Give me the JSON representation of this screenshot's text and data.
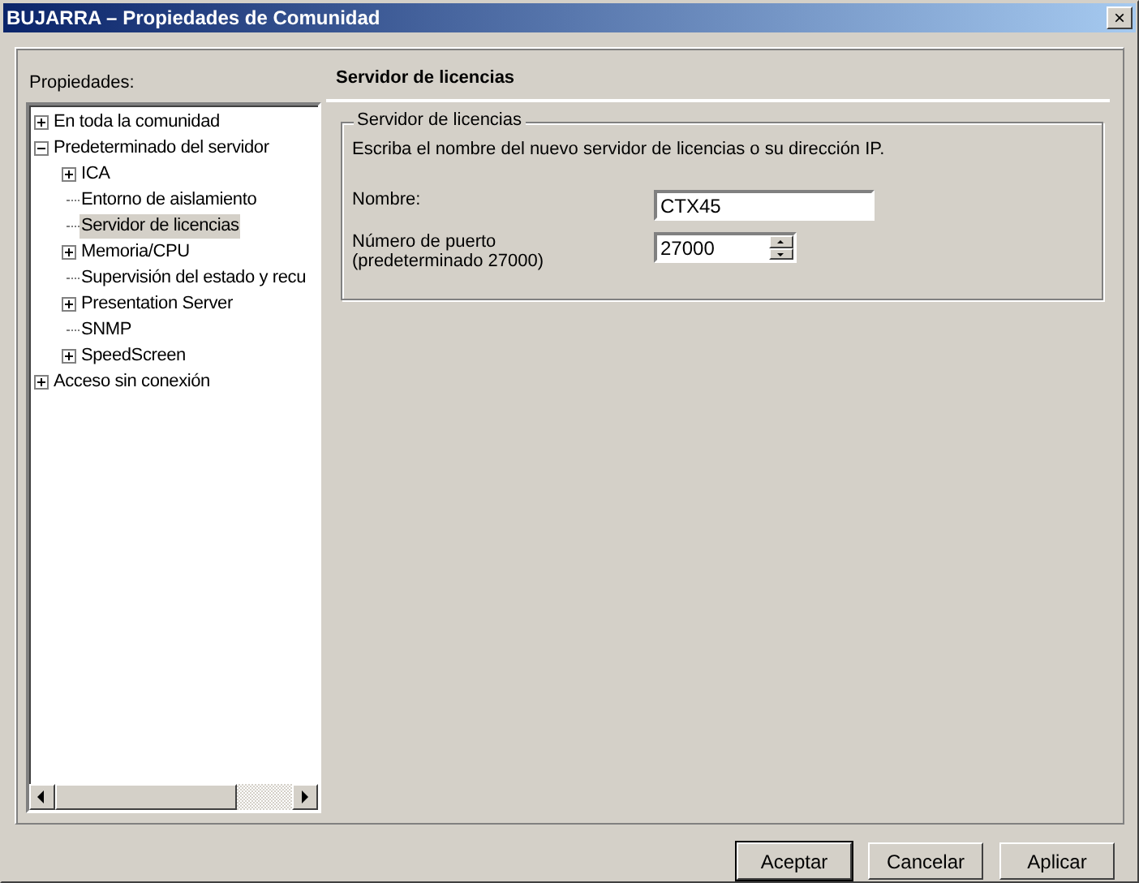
{
  "window": {
    "title": "BUJARRA – Propiedades de Comunidad",
    "close": "×"
  },
  "properties_label": "Propiedades:",
  "tree": [
    {
      "label": "En toda la comunidad",
      "kind": "folder",
      "expanded": false,
      "selected": false
    },
    {
      "label": "Predeterminado del servidor",
      "kind": "folder",
      "expanded": true,
      "selected": false,
      "children": [
        {
          "label": "ICA",
          "kind": "folder",
          "expanded": false,
          "selected": false
        },
        {
          "label": "Entorno de aislamiento",
          "kind": "leaf",
          "selected": false
        },
        {
          "label": "Servidor de licencias",
          "kind": "leaf",
          "selected": true
        },
        {
          "label": "Memoria/CPU",
          "kind": "folder",
          "expanded": false,
          "selected": false
        },
        {
          "label": "Supervisión del estado y recu",
          "kind": "leaf",
          "selected": false
        },
        {
          "label": "Presentation Server",
          "kind": "folder",
          "expanded": false,
          "selected": false
        },
        {
          "label": "SNMP",
          "kind": "leaf",
          "selected": false
        },
        {
          "label": "SpeedScreen",
          "kind": "folder",
          "expanded": false,
          "selected": false
        }
      ]
    },
    {
      "label": "Acceso sin conexión",
      "kind": "folder",
      "expanded": false,
      "selected": false
    }
  ],
  "page_title": "Servidor de licencias",
  "group": {
    "title": "Servidor de licencias",
    "description": "Escriba el nombre del nuevo servidor de licencias o su dirección IP.",
    "fields": [
      {
        "label": "Nombre:",
        "value": "CTX45",
        "kind": "text"
      },
      {
        "label": "Número de puerto (predeterminado 27000)",
        "value": "27000",
        "kind": "spin"
      }
    ]
  },
  "buttons": [
    {
      "label": "Aceptar",
      "default": true
    },
    {
      "label": "Cancelar",
      "default": false
    },
    {
      "label": "Aplicar",
      "default": false
    }
  ]
}
